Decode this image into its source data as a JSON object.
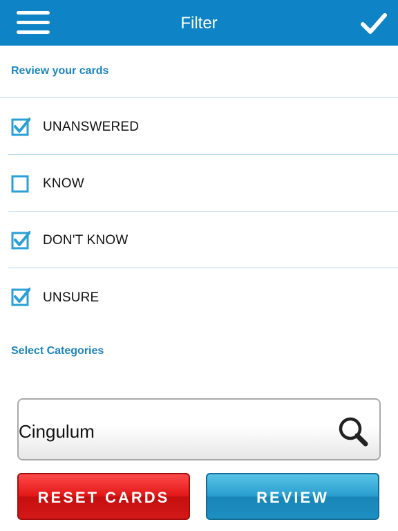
{
  "header": {
    "title": "Filter",
    "menu_icon": "menu-icon",
    "confirm_icon": "checkmark-icon",
    "color": "#0e83c6"
  },
  "review_section": {
    "label": "Review your cards",
    "options": [
      {
        "label": "UNANSWERED",
        "checked": true
      },
      {
        "label": "KNOW",
        "checked": false
      },
      {
        "label": "DON'T KNOW",
        "checked": true
      },
      {
        "label": "UNSURE",
        "checked": true
      }
    ]
  },
  "categories_section": {
    "label": "Select Categories",
    "search_value": "Cingulum",
    "search_icon": "magnifier-icon"
  },
  "buttons": {
    "reset_label": "RESET CARDS",
    "review_label": "REVIEW",
    "reset_color": "#e21818",
    "review_color": "#2a9fcf"
  }
}
